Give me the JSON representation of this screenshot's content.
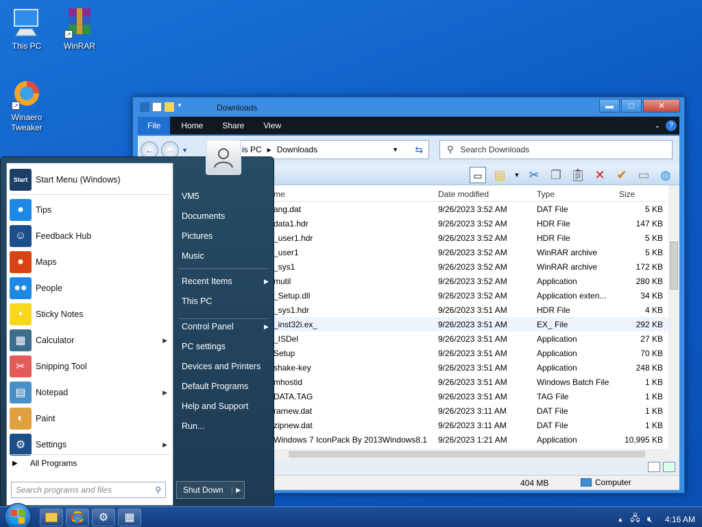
{
  "desktop": {
    "icons": [
      {
        "label": "This PC",
        "icon": "computer-icon"
      },
      {
        "label": "WinRAR",
        "icon": "winrar-icon"
      },
      {
        "label": "Winaero Tweaker",
        "icon": "tweaker-icon"
      }
    ]
  },
  "explorer": {
    "title": "Downloads",
    "window_controls": {
      "minimize": "▬",
      "maximize": "□",
      "close": "✕"
    },
    "ribbon_tabs": [
      "File",
      "Home",
      "Share",
      "View"
    ],
    "breadcrumb": [
      "is PC",
      "Downloads"
    ],
    "search_placeholder": "Search Downloads",
    "columns": {
      "name": "me",
      "date": "Date modified",
      "type": "Type",
      "size": "Size"
    },
    "files": [
      {
        "name": "ang.dat",
        "date": "9/26/2023 3:52 AM",
        "type": "DAT File",
        "size": "5 KB"
      },
      {
        "name": "data1.hdr",
        "date": "9/26/2023 3:52 AM",
        "type": "HDR File",
        "size": "147 KB"
      },
      {
        "name": "_user1.hdr",
        "date": "9/26/2023 3:52 AM",
        "type": "HDR File",
        "size": "5 KB"
      },
      {
        "name": "_user1",
        "date": "9/26/2023 3:52 AM",
        "type": "WinRAR archive",
        "size": "5 KB"
      },
      {
        "name": "_sys1",
        "date": "9/26/2023 3:52 AM",
        "type": "WinRAR archive",
        "size": "172 KB"
      },
      {
        "name": "mutil",
        "date": "9/26/2023 3:52 AM",
        "type": "Application",
        "size": "280 KB"
      },
      {
        "name": "_Setup.dll",
        "date": "9/26/2023 3:52 AM",
        "type": "Application exten...",
        "size": "34 KB"
      },
      {
        "name": "_sys1.hdr",
        "date": "9/26/2023 3:51 AM",
        "type": "HDR File",
        "size": "4 KB"
      },
      {
        "name": "_inst32i.ex_",
        "date": "9/26/2023 3:51 AM",
        "type": "EX_ File",
        "size": "292 KB"
      },
      {
        "name": "_ISDel",
        "date": "9/26/2023 3:51 AM",
        "type": "Application",
        "size": "27 KB"
      },
      {
        "name": "Setup",
        "date": "9/26/2023 3:51 AM",
        "type": "Application",
        "size": "70 KB"
      },
      {
        "name": "shake-key",
        "date": "9/26/2023 3:51 AM",
        "type": "Application",
        "size": "248 KB"
      },
      {
        "name": "mhostid",
        "date": "9/26/2023 3:51 AM",
        "type": "Windows Batch File",
        "size": "1 KB"
      },
      {
        "name": "DATA.TAG",
        "date": "9/26/2023 3:51 AM",
        "type": "TAG File",
        "size": "1 KB"
      },
      {
        "name": "rarnew.dat",
        "date": "9/26/2023 3:11 AM",
        "type": "DAT File",
        "size": "1 KB"
      },
      {
        "name": "zipnew.dat",
        "date": "9/26/2023 3:11 AM",
        "type": "DAT File",
        "size": "1 KB"
      },
      {
        "name": "Windows 7 IconPack By 2013Windows8.1",
        "date": "9/26/2023 1:21 AM",
        "type": "Application",
        "size": "10,995 KB"
      }
    ],
    "status": {
      "size": "404 MB",
      "location": "Computer"
    }
  },
  "start_menu": {
    "header_item": {
      "label": "Start Menu (Windows)",
      "icon_text": "Start"
    },
    "items": [
      {
        "label": "Tips",
        "icon": "tips-icon",
        "color": "#1e88e5",
        "glyph": "●",
        "submenu": false
      },
      {
        "label": "Feedback Hub",
        "icon": "feedback-hub-icon",
        "color": "#1b4f8a",
        "glyph": "☺",
        "submenu": false
      },
      {
        "label": "Maps",
        "icon": "maps-icon",
        "color": "#d84315",
        "glyph": "●",
        "submenu": false
      },
      {
        "label": "People",
        "icon": "people-icon",
        "color": "#1e88e5",
        "glyph": "●●",
        "submenu": false
      },
      {
        "label": "Sticky Notes",
        "icon": "sticky-notes-icon",
        "color": "#f9d71c",
        "glyph": "▪",
        "submenu": false
      },
      {
        "label": "Calculator",
        "icon": "calculator-icon",
        "color": "#3c6e8f",
        "glyph": "▦",
        "submenu": true
      },
      {
        "label": "Snipping Tool",
        "icon": "snipping-tool-icon",
        "color": "#e35b5b",
        "glyph": "✂",
        "submenu": false
      },
      {
        "label": "Notepad",
        "icon": "notepad-icon",
        "color": "#4a90c8",
        "glyph": "▤",
        "submenu": true
      },
      {
        "label": "Paint",
        "icon": "paint-icon",
        "color": "#e0a040",
        "glyph": "◐",
        "submenu": false
      },
      {
        "label": "Settings",
        "icon": "settings-icon",
        "color": "#1b4f8a",
        "glyph": "⚙",
        "submenu": true
      }
    ],
    "all_programs": "All Programs",
    "search_placeholder": "Search programs and files",
    "right_items": [
      {
        "label": "VM5",
        "submenu": false
      },
      {
        "label": "Documents",
        "submenu": false
      },
      {
        "label": "Pictures",
        "submenu": false
      },
      {
        "label": "Music",
        "submenu": false
      },
      {
        "label": "Recent Items",
        "submenu": true
      },
      {
        "label": "This PC",
        "submenu": false
      },
      {
        "label": "Control Panel",
        "submenu": true
      },
      {
        "label": "PC settings",
        "submenu": false
      },
      {
        "label": "Devices and Printers",
        "submenu": false
      },
      {
        "label": "Default Programs",
        "submenu": false
      },
      {
        "label": "Help and Support",
        "submenu": false
      },
      {
        "label": "Run...",
        "submenu": false
      }
    ],
    "shutdown": "Shut Down"
  },
  "taskbar": {
    "pinned": [
      "file-explorer-icon",
      "chrome-icon",
      "settings-icon",
      "calculator-icon"
    ],
    "clock": "4:16 AM"
  }
}
